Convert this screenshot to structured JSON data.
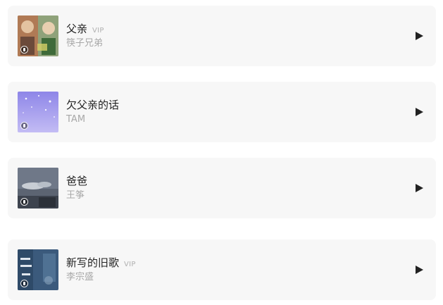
{
  "songs": [
    {
      "title": "父亲",
      "vip": "VIP",
      "artist": "筷子兄弟",
      "cover_icon": "album-cover-photo"
    },
    {
      "title": "欠父亲的话",
      "vip": "",
      "artist": "TAM",
      "cover_icon": "album-cover-purple"
    },
    {
      "title": "爸爸",
      "vip": "",
      "artist": "王筝",
      "cover_icon": "album-cover-sky"
    },
    {
      "title": "新写的旧歌",
      "vip": "VIP",
      "artist": "李宗盛",
      "cover_icon": "album-cover-blue"
    }
  ],
  "play_icon": "play-icon",
  "colors": {
    "card_bg": "#f7f7f7",
    "title": "#222222",
    "subtitle": "#a8a8a8",
    "vip": "#b0b0b0",
    "play": "#222222"
  }
}
